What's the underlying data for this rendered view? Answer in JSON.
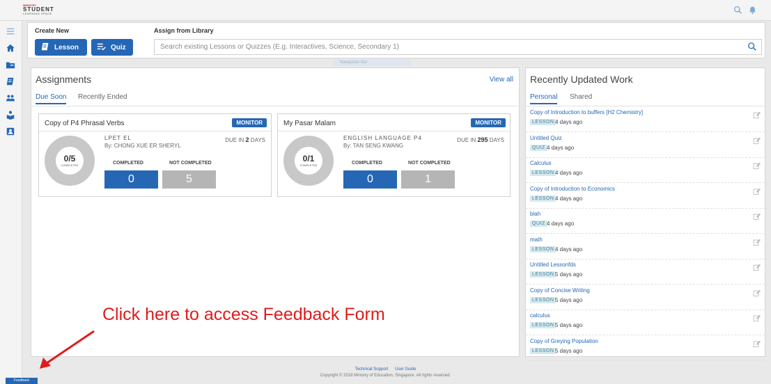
{
  "header": {
    "logo_line1": "MINISTRY",
    "logo_line2": "STUDENT",
    "logo_line3": "LEARNING SPACE"
  },
  "create": {
    "create_label": "Create New",
    "assign_label": "Assign from Library",
    "lesson_label": "Lesson",
    "quiz_label": "Quiz",
    "search_placeholder": "Search existing Lessons or Quizzes (E.g. Interactives, Science, Secondary 1)",
    "nav_strip": "Navigation Bar"
  },
  "assignments": {
    "title": "Assignments",
    "view_all": "View all",
    "tabs": [
      "Due Soon",
      "Recently Ended"
    ],
    "cards": [
      {
        "title": "Copy of P4 Phrasal Verbs",
        "monitor": "MONITOR",
        "donut_value": "0/5",
        "donut_sub": "COMPLETED",
        "class_name": "LPET EL",
        "by": "By: CHONG XUE ER SHERYL",
        "due_prefix": "DUE IN",
        "due_num": "2",
        "due_unit": "DAYS",
        "completed_label": "COMPLETED",
        "not_completed_label": "NOT COMPLETED",
        "completed": "0",
        "not_completed": "5",
        "progress": 0
      },
      {
        "title": "My Pasar Malam",
        "monitor": "MONITOR",
        "donut_value": "0/1",
        "donut_sub": "COMPLETED",
        "class_name": "ENGLISH LANGUAGE P4",
        "by": "By: TAN SENG KWANG",
        "due_prefix": "DUE IN",
        "due_num": "295",
        "due_unit": "DAYS",
        "completed_label": "COMPLETED",
        "not_completed_label": "NOT COMPLETED",
        "completed": "0",
        "not_completed": "1",
        "progress": 0
      }
    ]
  },
  "recent": {
    "title": "Recently Updated Work",
    "tabs": [
      "Personal",
      "Shared"
    ],
    "items": [
      {
        "title": "Copy of Introduction to buffers [H2 Chemistry]",
        "type": "LESSON",
        "ago": "4 days ago"
      },
      {
        "title": "Untitled Quiz",
        "type": "QUIZ",
        "ago": "4 days ago"
      },
      {
        "title": "Calculus",
        "type": "LESSON",
        "ago": "4 days ago"
      },
      {
        "title": "Copy of Introduction to Economics",
        "type": "LESSON",
        "ago": "4 days ago"
      },
      {
        "title": "blah",
        "type": "QUIZ",
        "ago": "4 days ago"
      },
      {
        "title": "math",
        "type": "LESSON",
        "ago": "4 days ago"
      },
      {
        "title": "Untitled Lessonfds",
        "type": "LESSON",
        "ago": "5 days ago"
      },
      {
        "title": "Copy of Concise Writing",
        "type": "LESSON",
        "ago": "5 days ago"
      },
      {
        "title": "calculus",
        "type": "LESSON",
        "ago": "5 days ago"
      },
      {
        "title": "Copy of Greying Population",
        "type": "LESSON",
        "ago": "5 days ago"
      }
    ]
  },
  "annotation": {
    "text": "Click here to access Feedback Form"
  },
  "footer": {
    "links": [
      "Technical Support",
      "User Guide"
    ],
    "copyright": "Copyright © 2018 Ministry of Education, Singapore. All rights reserved.",
    "feedback_label": "Feedback"
  },
  "icons": [
    "menu-icon",
    "home-icon",
    "class-icon",
    "lesson-icon",
    "groups-icon",
    "library-icon",
    "profile-icon",
    "search-icon",
    "bell-icon",
    "edit-icon"
  ],
  "colors": {
    "accent": "#2567b5",
    "annotation": "#e01b1b",
    "badge_bg": "#d4e9ef",
    "gray_box": "#b5b5b5"
  }
}
